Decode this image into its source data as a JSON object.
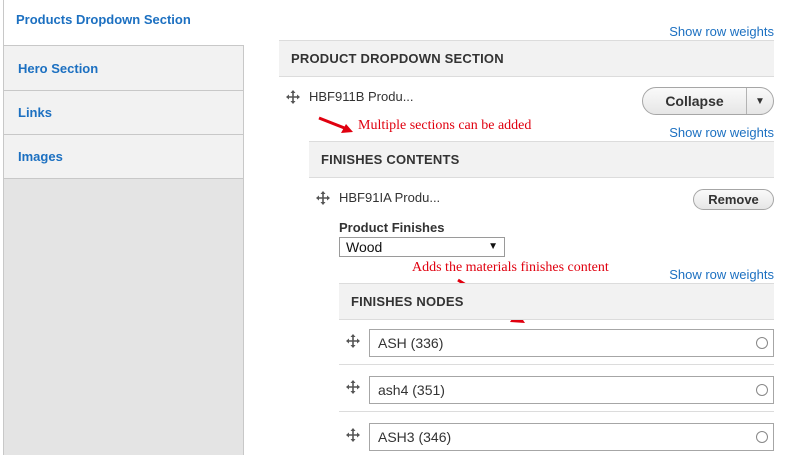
{
  "tabs": [
    {
      "label": "Products Dropdown Section",
      "active": true
    },
    {
      "label": "Hero Section"
    },
    {
      "label": "Links"
    },
    {
      "label": "Images"
    }
  ],
  "links": {
    "show_row_weights": "Show row weights"
  },
  "product_dropdown": {
    "header": "PRODUCT DROPDOWN SECTION",
    "row_title": "HBF911B Produ...",
    "collapse_label": "Collapse"
  },
  "finishes_contents": {
    "header": "FINISHES CONTENTS",
    "row_title": "HBF91IA Produ...",
    "remove_label": "Remove",
    "product_finishes_label": "Product Finishes",
    "product_finishes_value": "Wood"
  },
  "finishes_nodes": {
    "header": "FINISHES NODES",
    "items": [
      "ASH (336)",
      "ash4 (351)",
      "ASH3 (346)"
    ]
  },
  "annotations": {
    "multiple_sections": "Multiple sections can be added",
    "adds_materials": "Adds the materials finishes content",
    "color": "#e0000f"
  },
  "colors": {
    "link": "#1c70c1",
    "annotation": "#e0000f"
  },
  "icons": [
    "drag-handle-icon",
    "chevron-down-icon",
    "autocomplete-throbber-icon",
    "red-arrow-icon"
  ]
}
